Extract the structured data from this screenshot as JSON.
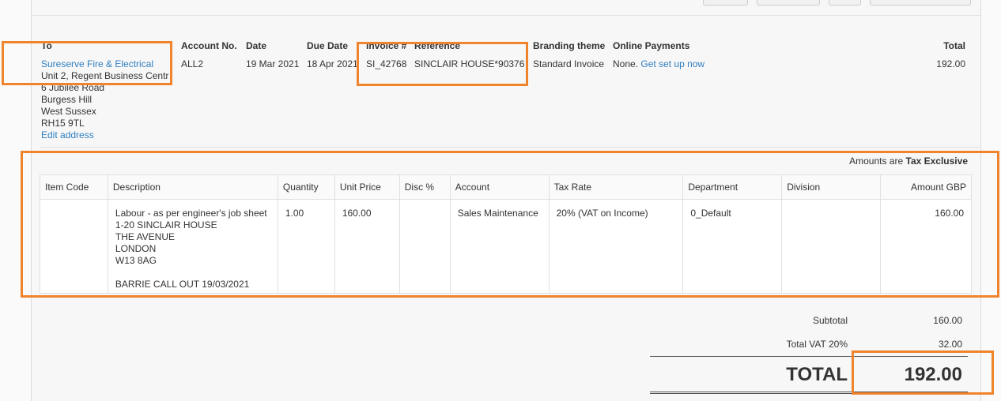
{
  "invoice": {
    "to_label": "To",
    "to_name": "Sureserve Fire & Electrical",
    "address_lines": [
      "Unit 2, Regent Business Centr",
      "6 Jubilee Road",
      "Burgess Hill",
      "West Sussex",
      "RH15 9TL"
    ],
    "edit_address": "Edit address",
    "account_no_label": "Account No.",
    "account_no": "ALL2",
    "date_label": "Date",
    "date": "19 Mar 2021",
    "due_date_label": "Due Date",
    "due_date": "18 Apr 2021",
    "invoice_no_label": "Invoice #",
    "invoice_no": "SI_42768",
    "reference_label": "Reference",
    "reference": "SINCLAIR HOUSE*90376",
    "branding_label": "Branding theme",
    "branding": "Standard Invoice",
    "online_payments_label": "Online Payments",
    "online_payments_value": "None.",
    "online_payments_link": "Get set up now",
    "total_label": "Total",
    "total": "192.00"
  },
  "amounts_note": {
    "prefix": "Amounts are",
    "value": "Tax Exclusive"
  },
  "table": {
    "headers": [
      "Item Code",
      "Description",
      "Quantity",
      "Unit Price",
      "Disc %",
      "Account",
      "Tax Rate",
      "Department",
      "Division",
      "Amount GBP"
    ],
    "row": {
      "item_code": "",
      "description_lines": [
        "Labour - as per engineer's job sheet",
        "1-20 SINCLAIR HOUSE",
        "THE AVENUE",
        "LONDON",
        "W13 8AG",
        "",
        "BARRIE CALL OUT 19/03/2021"
      ],
      "quantity": "1.00",
      "unit_price": "160.00",
      "disc": "",
      "account": "Sales Maintenance",
      "tax_rate": "20% (VAT on Income)",
      "department": "0_Default",
      "division": "",
      "amount": "160.00"
    }
  },
  "totals": {
    "subtotal_label": "Subtotal",
    "subtotal": "160.00",
    "vat_label": "Total VAT  20%",
    "vat": "32.00",
    "total_label": "TOTAL",
    "total": "192.00"
  },
  "colors": {
    "highlight": "#f0842c",
    "link": "#2f7ec0"
  }
}
